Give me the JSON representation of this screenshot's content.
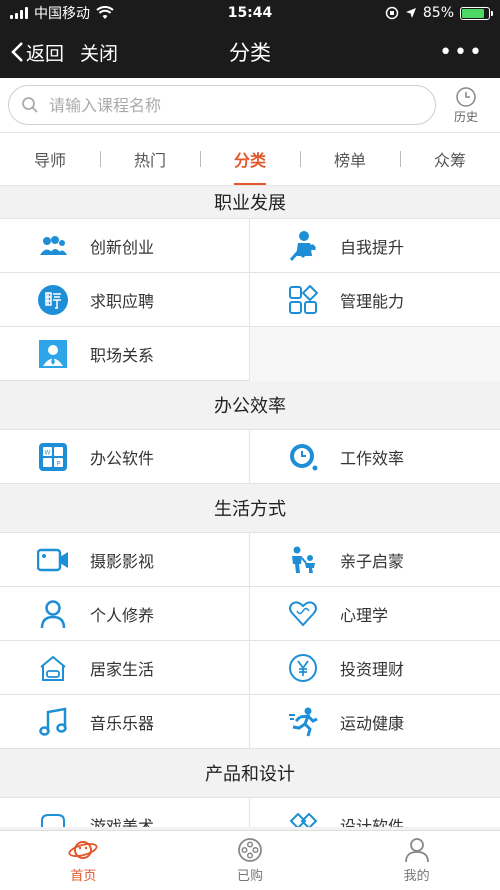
{
  "status_bar": {
    "carrier": "中国移动",
    "time": "15:44",
    "battery": "85%",
    "battery_level": 0.85
  },
  "nav": {
    "back": "返回",
    "close": "关闭",
    "title": "分类",
    "more": "•••"
  },
  "search": {
    "placeholder": "请输入课程名称",
    "history": "历史"
  },
  "tabs": [
    {
      "label": "导师"
    },
    {
      "label": "热门"
    },
    {
      "label": "分类",
      "active": true
    },
    {
      "label": "榜单"
    },
    {
      "label": "众筹"
    }
  ],
  "sections": [
    {
      "title": "职业发展",
      "items": [
        {
          "label": "创新创业",
          "icon": "people-group-icon"
        },
        {
          "label": "自我提升",
          "icon": "person-growth-icon"
        },
        {
          "label": "求职应聘",
          "icon": "hire-badge-icon"
        },
        {
          "label": "管理能力",
          "icon": "grid-shapes-icon"
        },
        {
          "label": "职场关系",
          "icon": "id-card-icon"
        }
      ]
    },
    {
      "title": "办公效率",
      "items": [
        {
          "label": "办公软件",
          "icon": "office-apps-icon"
        },
        {
          "label": "工作效率",
          "icon": "clock-icon"
        }
      ]
    },
    {
      "title": "生活方式",
      "items": [
        {
          "label": "摄影影视",
          "icon": "video-camera-icon"
        },
        {
          "label": "亲子启蒙",
          "icon": "parent-child-icon"
        },
        {
          "label": "个人修养",
          "icon": "person-icon"
        },
        {
          "label": "心理学",
          "icon": "heart-icon"
        },
        {
          "label": "居家生活",
          "icon": "home-icon"
        },
        {
          "label": "投资理财",
          "icon": "yen-icon"
        },
        {
          "label": "音乐乐器",
          "icon": "music-note-icon"
        },
        {
          "label": "运动健康",
          "icon": "running-icon"
        }
      ]
    },
    {
      "title": "产品和设计",
      "items": [
        {
          "label": "游戏美术",
          "icon": "game-icon"
        },
        {
          "label": "设计软件",
          "icon": "design-tools-icon"
        }
      ]
    }
  ],
  "tabbar": [
    {
      "label": "首页",
      "icon": "planet-icon",
      "active": true
    },
    {
      "label": "已购",
      "icon": "film-reel-icon"
    },
    {
      "label": "我的",
      "icon": "user-icon"
    }
  ],
  "colors": {
    "accent": "#e4572b",
    "icon_blue": "#1e8fd6",
    "nav_bg": "#1b1b1b"
  }
}
